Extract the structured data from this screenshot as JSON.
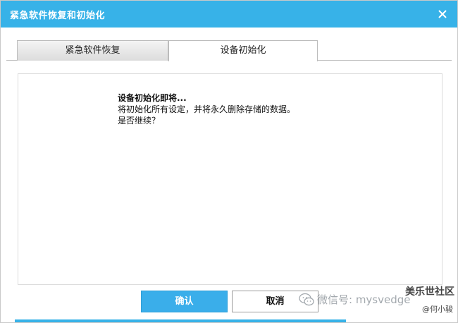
{
  "window": {
    "title": "紧急软件恢复和初始化"
  },
  "tabs": [
    {
      "label": "紧急软件恢复",
      "active": false
    },
    {
      "label": "设备初始化",
      "active": true
    }
  ],
  "message": {
    "heading": "设备初始化即将...",
    "body": "将初始化所有设定，并将永久删除存储的数据。",
    "question": "是否继续？"
  },
  "buttons": {
    "ok_label": "确认",
    "cancel_label": "取消"
  },
  "watermark": {
    "wechat_text": "微信号: mysvedge",
    "brand": "美乐世社区",
    "author": "@何小骏"
  },
  "colors": {
    "titlebar": "#37b2e8",
    "ok_button": "#3aaeea"
  },
  "icons": {
    "close": "close-icon",
    "wechat": "wechat-icon"
  }
}
